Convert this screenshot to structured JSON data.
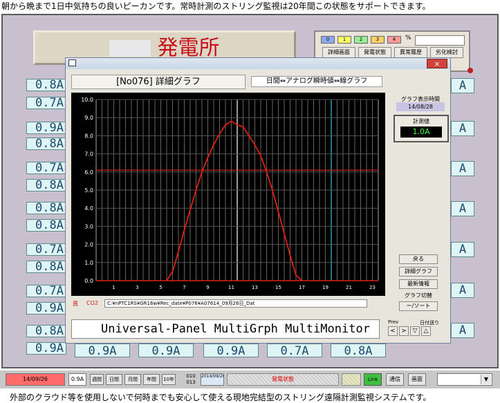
{
  "top_caption": "朝から晩まで1日中気持ちの良いピーカンです。常時計測のストリング監視は20年間この状態をサポートできます。",
  "bottom_caption": "外部のクラウド等を使用しないで何時までも安心して使える現地完結型のストリング遠隔計測監視システムです。",
  "station": {
    "title": "発電所"
  },
  "top_controls": {
    "swatches": [
      {
        "label": "0",
        "color": "#8fa9f0"
      },
      {
        "label": "1",
        "color": "#ffff66"
      },
      {
        "label": "2",
        "color": "#99ee99"
      },
      {
        "label": "3",
        "color": "#ffd06a"
      },
      {
        "label": "4",
        "color": "#ff9a9a"
      }
    ],
    "unit_mark": "%",
    "buttons": [
      "詳細画面",
      "発電状態",
      "異常履歴",
      "劣化検討"
    ]
  },
  "left_col1": [
    "0.8A",
    "0.7A",
    "0.9A",
    "0.8A",
    "0.7A",
    "0.8A",
    "0.8A",
    "0.8A",
    "0.7A",
    "0.8A",
    "0.7A",
    "0.9A",
    "0.8A",
    "0.9A"
  ],
  "right_col": [
    "A",
    "A",
    "A",
    "A",
    "A",
    "A",
    "A",
    "A",
    "A",
    "A"
  ],
  "bottom_row": [
    "0.9A",
    "0.9A",
    "0.9A",
    "0.7A",
    "0.8A"
  ],
  "dialog": {
    "title_icon": "window-icon",
    "close_label": "×",
    "header_title": "[No076] 詳細グラフ",
    "mode_label": "日間⇔アナログ瞬時値⇔線グラフ",
    "display_time_label": "グラフ表示時間",
    "display_time_value": "14/08/28",
    "measure_label": "計測値",
    "measure_value": "1.0A",
    "buttons": [
      "戻る",
      "詳細グラフ",
      "最新情報",
      "グラフ切替"
    ],
    "toggle_label": "ー/ソート",
    "file_path": "C:¥nPTC1RS¥GR16w¥Rec_date¥P076¥A07614_09月26日_Dat",
    "error_marks": [
      "異",
      "CO2"
    ],
    "footer_text": "Universal-Panel MultiGrph MultiMonitor",
    "nav_labels": [
      "Prev",
      "日付送り"
    ],
    "nav_buttons": [
      "<",
      ">",
      "▽",
      "△"
    ]
  },
  "chart_data": {
    "type": "line",
    "title": "",
    "xlabel": "",
    "ylabel": "",
    "ylim": [
      0,
      10
    ],
    "yticks": [
      "0.0",
      "1.0",
      "2.0",
      "3.0",
      "4.0",
      "5.0",
      "6.0",
      "7.0",
      "8.0",
      "9.0",
      "10.0"
    ],
    "xticks": [
      "1",
      "3",
      "5",
      "7",
      "9",
      "11",
      "13",
      "15",
      "17",
      "19",
      "21",
      "23"
    ],
    "threshold": 6.1,
    "series_color": "#e02010",
    "x": [
      6.0,
      6.5,
      7.0,
      7.5,
      8.0,
      8.5,
      9.0,
      9.5,
      10.0,
      10.5,
      11.0,
      11.5,
      12.0,
      12.5,
      13.0,
      13.5,
      14.0,
      14.5,
      15.0,
      15.5,
      16.0,
      16.5,
      17.0,
      17.5
    ],
    "values": [
      0.0,
      0.5,
      1.6,
      2.8,
      3.9,
      5.0,
      6.0,
      6.8,
      7.5,
      8.1,
      8.6,
      8.8,
      8.6,
      8.5,
      8.0,
      7.5,
      6.9,
      6.0,
      5.0,
      3.8,
      2.6,
      1.4,
      0.3,
      0.0
    ]
  },
  "status_bar": {
    "date": "14/09/26",
    "value_text": "0.9A",
    "period_buttons": [
      "週間",
      "日間",
      "月間",
      "年間",
      "10年"
    ],
    "counters": [
      "010",
      "013"
    ],
    "info_text": "2014/09/26",
    "status_text": "発電状態",
    "status_color": "#ff6060",
    "green_label": "Link",
    "labels": [
      "通信",
      "画面"
    ],
    "select_value": ""
  }
}
